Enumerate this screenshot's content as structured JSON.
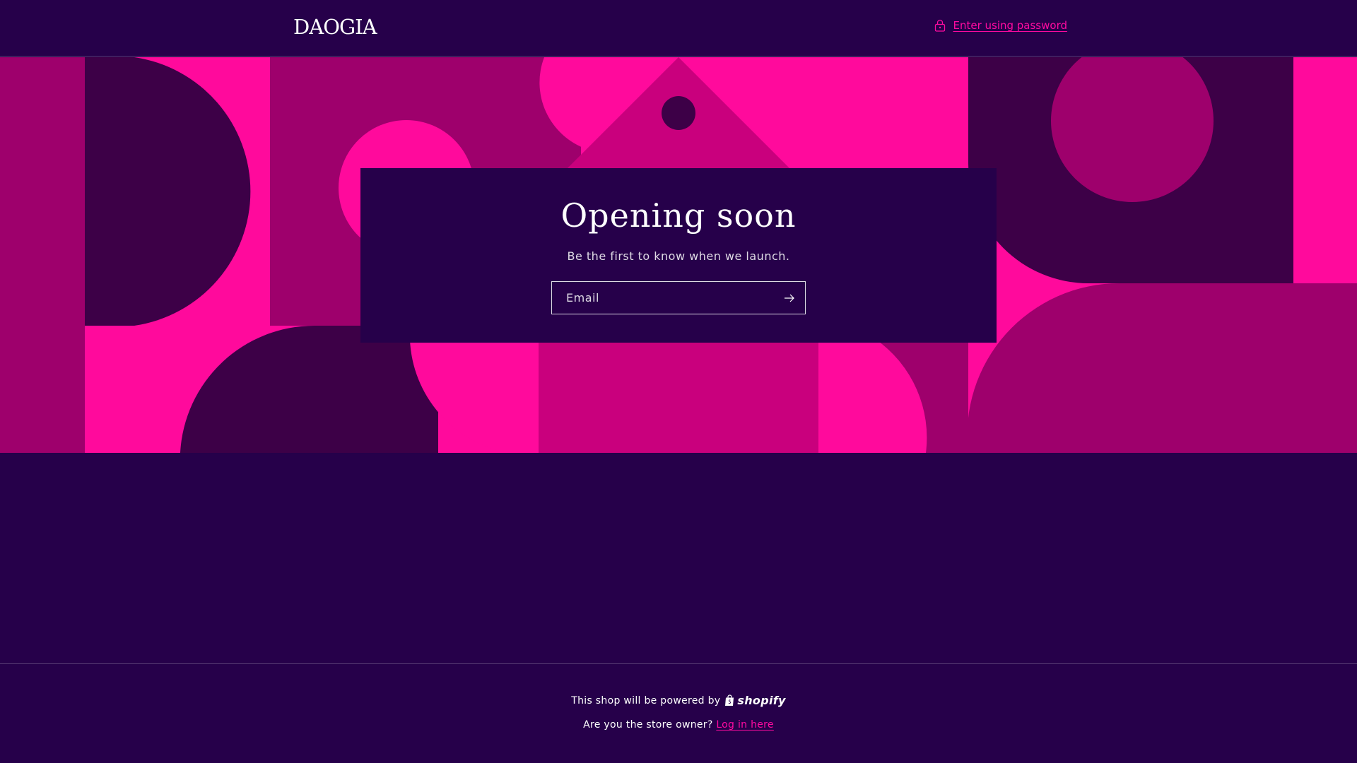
{
  "header": {
    "logo_text": "DAOGIA",
    "password_link": "Enter using password",
    "lock_icon": "lock-icon"
  },
  "banner": {
    "colors": {
      "dark": "#3d0047",
      "magenta": "#9e006c",
      "pink": "#ff0a9c",
      "mid": "#c9007d"
    }
  },
  "newsletter": {
    "title": "Opening soon",
    "subtitle": "Be the first to know when we launch.",
    "email_placeholder": "Email",
    "submit_icon": "arrow-right-icon"
  },
  "footer": {
    "powered_text": "This shop will be powered by",
    "shopify_label": "shopify",
    "owner_text": "Are you the store owner?",
    "login_link": "Log in here"
  },
  "theme": {
    "background": "#26004a",
    "accent": "#ff0aa0",
    "text": "#ffffff"
  }
}
